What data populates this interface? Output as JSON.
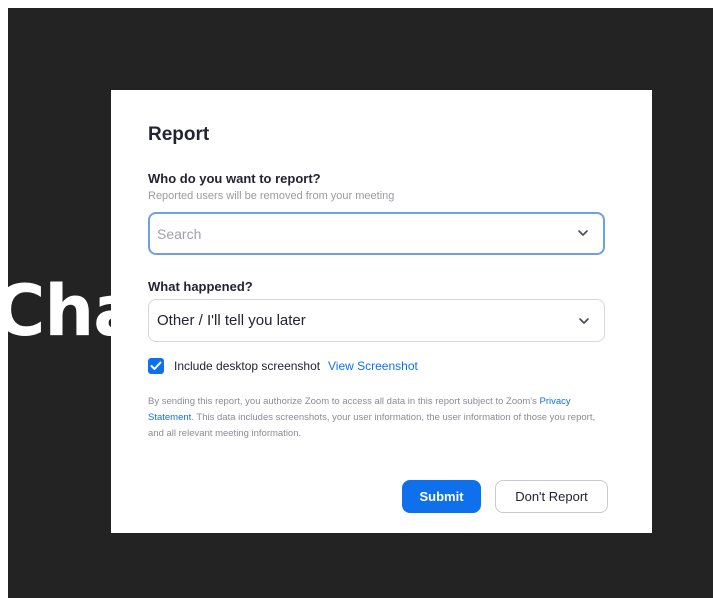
{
  "background": {
    "text": "Cha"
  },
  "dialog": {
    "title": "Report",
    "who": {
      "label": "Who do you want to report?",
      "sublabel": "Reported users will be removed from your meeting",
      "placeholder": "Search"
    },
    "what": {
      "label": "What happened?",
      "selected": "Other / I'll tell you later"
    },
    "screenshot": {
      "checked": true,
      "label": "Include desktop screenshot",
      "link": "View Screenshot"
    },
    "disclaimer": {
      "before": "By sending this report, you authorize Zoom to access all data in this report subject to Zoom's ",
      "link": "Privacy Statement",
      "after": ". This data includes screenshots, your user information, the user information of those you report, and all relevant meeting information."
    },
    "buttons": {
      "submit": "Submit",
      "cancel": "Don't Report"
    }
  },
  "colors": {
    "accent": "#0e71eb",
    "backdrop": "#232323",
    "focus_border": "#6ea0e6"
  },
  "icons": {
    "dropdown": "chevron-down-icon",
    "checkbox": "checkmark-icon"
  }
}
